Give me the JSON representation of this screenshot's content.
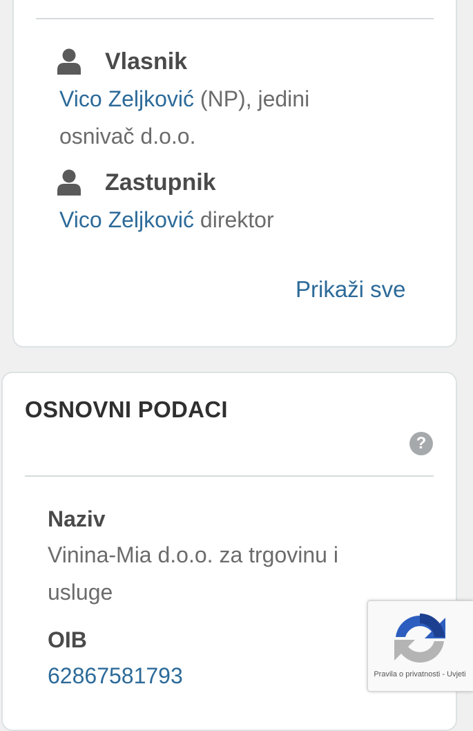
{
  "people_card": {
    "owner": {
      "label": "Vlasnik",
      "name": "Vico Zeljković",
      "detail_line1": " (NP), jedini",
      "detail_line2": "osnivač d.o.o."
    },
    "representative": {
      "label": "Zastupnik",
      "name": "Vico Zeljković",
      "detail": " direktor"
    },
    "show_all_label": "Prikaži sve"
  },
  "basic_card": {
    "title": "OSNOVNI PODACI",
    "help_icon_glyph": "?",
    "name_label": "Naziv",
    "name_line1": "Vinina-Mia d.o.o. za trgovinu i",
    "name_line2": "usluge",
    "oib_label": "OIB",
    "oib_value": "62867581793"
  },
  "recaptcha": {
    "privacy_label": "Pravila o privatnosti",
    "separator": " - ",
    "terms_label": "Uvjeti"
  },
  "colors": {
    "link": "#2c6a99",
    "text": "#6b6b6b",
    "heading": "#4a4a4a",
    "background": "#f0f0f0",
    "card": "#ffffff"
  }
}
